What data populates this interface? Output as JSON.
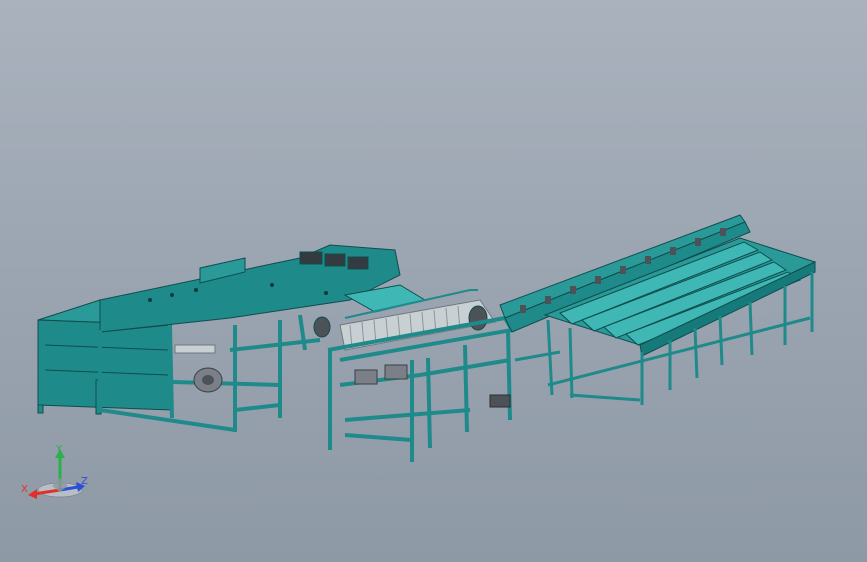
{
  "viewport": {
    "background_top": "#a9b2bd",
    "background_bottom": "#8e99a6"
  },
  "model": {
    "frame_color": "#1f8a8a",
    "frame_dark": "#146a6a",
    "plate_light": "#3fb7b5",
    "belt_color": "#c9d0d4",
    "motor_color": "#7b8088"
  },
  "triad": {
    "x_label": "X",
    "y_label": "Y",
    "z_label": "Z",
    "x_color": "#e0302a",
    "y_color": "#27b24a",
    "z_color": "#2b4fd6"
  }
}
